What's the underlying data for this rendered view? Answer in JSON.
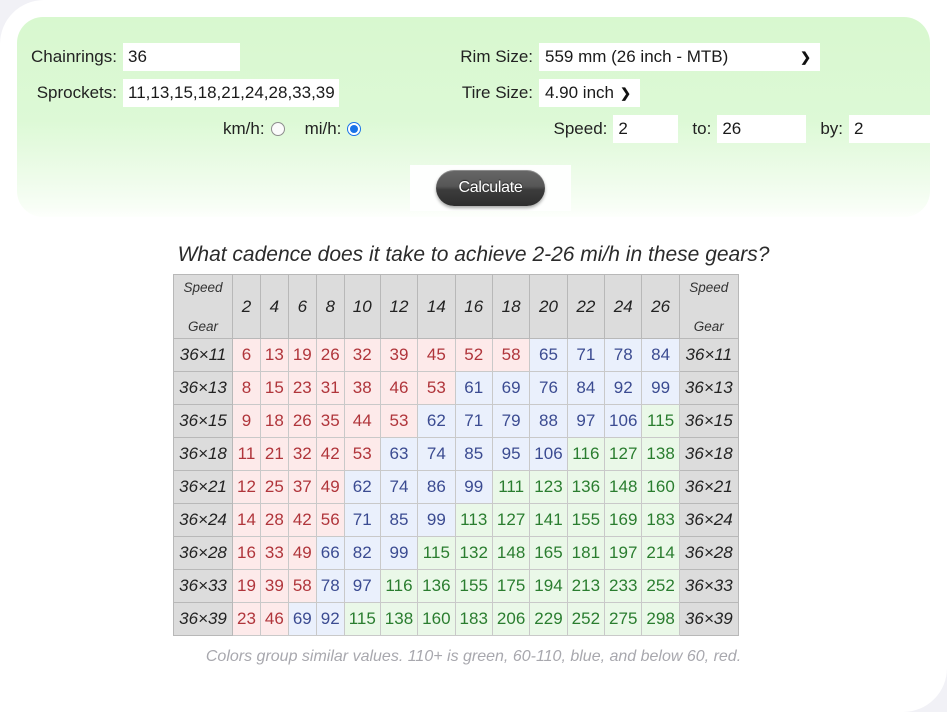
{
  "form": {
    "chainrings_label": "Chainrings:",
    "chainrings_value": "36",
    "sprockets_label": "Sprockets:",
    "sprockets_value": "11,13,15,18,21,24,28,33,39",
    "kmh_label": "km/h:",
    "mih_label": "mi/h:",
    "rim_label": "Rim Size:",
    "rim_value": "559 mm (26 inch - MTB)",
    "tire_label": "Tire Size:",
    "tire_value": "4.90 inch",
    "speed_label": "Speed:",
    "speed_from": "2",
    "to_label": "to:",
    "speed_to": "26",
    "by_label": "by:",
    "speed_by": "2",
    "calculate_label": "Calculate"
  },
  "results": {
    "question": "What cadence does it take to achieve 2-26 mi/h in these gears?",
    "legend": "Colors group similar values. 110+ is green, 60-110, blue, and below 60, red.",
    "corner_top": "Speed",
    "corner_bottom": "Gear"
  },
  "colors": {
    "page_bg": "#f1f1f6",
    "card_bg": "#ffffff",
    "panel_green": "#d8f8cf",
    "red_text": "#b0353b",
    "red_bg": "#fdeaea",
    "blue_text": "#3b4b91",
    "blue_bg": "#eaf0fc",
    "green_text": "#2a7d2f",
    "green_bg": "#eaf8e8",
    "header_bg": "#dcdcdc",
    "radio_on": "#1a73e8"
  },
  "chart_data": {
    "type": "table",
    "title": "What cadence does it take to achieve 2-26 mi/h in these gears?",
    "xlabel": "Speed (mi/h)",
    "ylabel": "Gear (chainring × sprocket)",
    "unit": "rpm cadence",
    "categories": [
      "2",
      "4",
      "6",
      "8",
      "10",
      "12",
      "14",
      "16",
      "18",
      "20",
      "22",
      "24",
      "26"
    ],
    "row_labels": [
      "36×11",
      "36×13",
      "36×15",
      "36×18",
      "36×21",
      "36×24",
      "36×28",
      "36×33",
      "36×39"
    ],
    "thresholds": {
      "green_min": 110,
      "blue_min": 60,
      "red_max": 59
    },
    "series": [
      {
        "name": "36×11",
        "values": [
          6,
          13,
          19,
          26,
          32,
          39,
          45,
          52,
          58,
          65,
          71,
          78,
          84
        ]
      },
      {
        "name": "36×13",
        "values": [
          8,
          15,
          23,
          31,
          38,
          46,
          53,
          61,
          69,
          76,
          84,
          92,
          99
        ]
      },
      {
        "name": "36×15",
        "values": [
          9,
          18,
          26,
          35,
          44,
          53,
          62,
          71,
          79,
          88,
          97,
          106,
          115
        ]
      },
      {
        "name": "36×18",
        "values": [
          11,
          21,
          32,
          42,
          53,
          63,
          74,
          85,
          95,
          106,
          116,
          127,
          138
        ]
      },
      {
        "name": "36×21",
        "values": [
          12,
          25,
          37,
          49,
          62,
          74,
          86,
          99,
          111,
          123,
          136,
          148,
          160
        ]
      },
      {
        "name": "36×24",
        "values": [
          14,
          28,
          42,
          56,
          71,
          85,
          99,
          113,
          127,
          141,
          155,
          169,
          183
        ]
      },
      {
        "name": "36×28",
        "values": [
          16,
          33,
          49,
          66,
          82,
          99,
          115,
          132,
          148,
          165,
          181,
          197,
          214
        ]
      },
      {
        "name": "36×33",
        "values": [
          19,
          39,
          58,
          78,
          97,
          116,
          136,
          155,
          175,
          194,
          213,
          233,
          252
        ]
      },
      {
        "name": "36×39",
        "values": [
          23,
          46,
          69,
          92,
          115,
          138,
          160,
          183,
          206,
          229,
          252,
          275,
          298
        ]
      }
    ]
  }
}
